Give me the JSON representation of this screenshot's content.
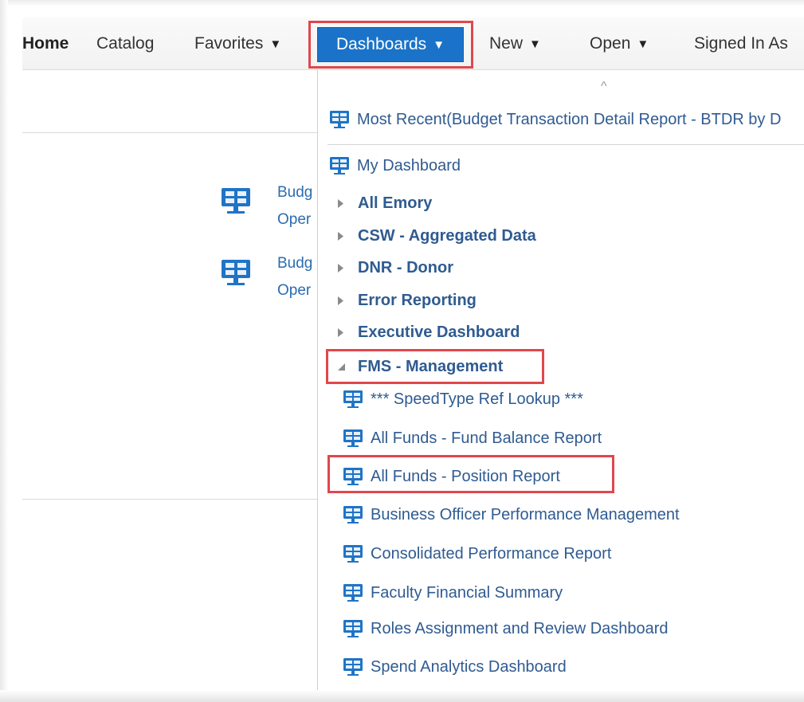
{
  "nav": {
    "home": "Home",
    "catalog": "Catalog",
    "favorites": "Favorites",
    "dashboards": "Dashboards",
    "new": "New",
    "open": "Open",
    "signed_in": "Signed In As",
    "caret": "▼"
  },
  "background": {
    "items": [
      {
        "line1": "Budg",
        "line2": "Oper"
      },
      {
        "line1": "Budg",
        "line2": "Oper"
      }
    ]
  },
  "dropdown": {
    "scroll_up": "^",
    "most_recent": "Most Recent(Budget Transaction Detail Report - BTDR by D",
    "my_dashboard": "My Dashboard",
    "folders": [
      "All Emory",
      "CSW - Aggregated Data",
      "DNR - Donor",
      "Error Reporting",
      "Executive Dashboard",
      "FMS - Management"
    ],
    "fms_items": [
      "*** SpeedType Ref Lookup ***",
      "All Funds - Fund Balance Report",
      "All Funds - Position Report",
      "Business Officer Performance Management",
      "Consolidated Performance Report",
      "Faculty Financial Summary",
      "Roles Assignment and Review Dashboard",
      "Spend Analytics Dashboard"
    ]
  },
  "colors": {
    "accent": "#1a73c9",
    "highlight": "#e0474c",
    "link": "#2f5b91"
  }
}
